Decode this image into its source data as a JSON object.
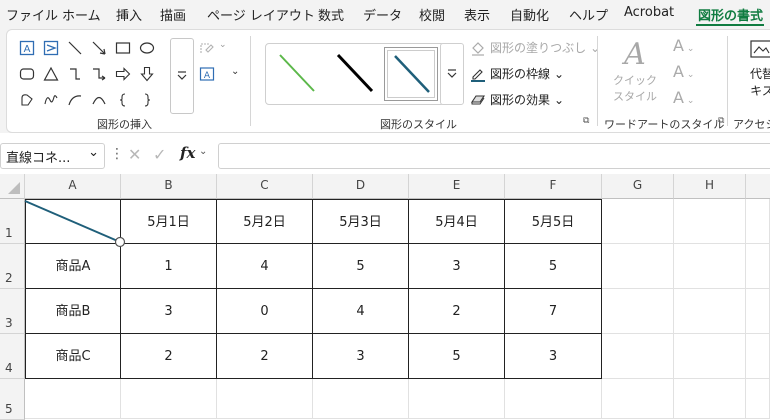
{
  "menu": {
    "items": [
      "ファイル",
      "ホーム",
      "挿入",
      "描画",
      "ページ レイアウト",
      "数式",
      "データ",
      "校閲",
      "表示",
      "自動化",
      "ヘルプ",
      "Acrobat",
      "図形の書式"
    ],
    "active": "図形の書式"
  },
  "ribbon": {
    "insert_shapes_label": "図形の挿入",
    "shape_styles_label": "図形のスタイル",
    "wordart_label": "ワードアートのスタイル",
    "accessibility_label": "アクセシビ",
    "fill_label": "図形の塗りつぶし",
    "outline_label": "図形の枠線",
    "effect_label": "図形の効果",
    "quick_style_line1": "クイック",
    "quick_style_line2": "スタイル",
    "alt_text_line1": "代替",
    "alt_text_line2": "キス",
    "style_colors": [
      "#5cb84a",
      "#000000",
      "#1f5f7a"
    ]
  },
  "formula_bar": {
    "name_box": "直線コネ...",
    "fx_label": "fx",
    "formula_value": ""
  },
  "sheet": {
    "columns": [
      "A",
      "B",
      "C",
      "D",
      "E",
      "F",
      "G",
      "H"
    ],
    "rows": [
      "1",
      "2",
      "3",
      "4",
      "5"
    ],
    "header_row": [
      "",
      "5月1日",
      "5月2日",
      "5月3日",
      "5月4日",
      "5月5日"
    ],
    "data_rows": [
      {
        "label": "商品A",
        "values": [
          "1",
          "4",
          "5",
          "3",
          "5"
        ]
      },
      {
        "label": "商品B",
        "values": [
          "3",
          "0",
          "4",
          "2",
          "7"
        ]
      },
      {
        "label": "商品C",
        "values": [
          "2",
          "2",
          "3",
          "5",
          "3"
        ]
      }
    ],
    "connector_color": "#1f5f7a"
  }
}
